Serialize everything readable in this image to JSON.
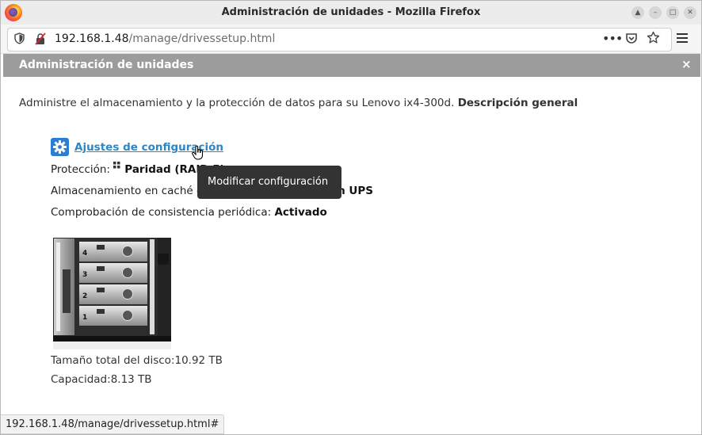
{
  "window": {
    "title": "Administración de unidades - Mozilla Firefox"
  },
  "navbar": {
    "url_host": "192.168.1.48",
    "url_path": "/manage/drivessetup.html",
    "icons": [
      "shield-icon",
      "insecure-lock-icon",
      "more-actions-icon",
      "pocket-icon",
      "bookmark-star-icon",
      "menu-icon"
    ]
  },
  "panel": {
    "title": "Administración de unidades",
    "close_label": "×"
  },
  "intro": {
    "text": "Administre el almacenamiento y la protección de datos para su Lenovo ix4-300d.",
    "link": "Descripción general"
  },
  "settings": {
    "link_label": "Ajustes de configuración",
    "protection_label": "Protección:",
    "protection_value": "Paridad (RAID 5)",
    "cache_label": "Almacenamiento en caché de escritura:",
    "cache_value": "Activado con UPS",
    "consistency_label": "Comprobación de consistencia periódica:",
    "consistency_value": "Activado",
    "tooltip": "Modificar configuración"
  },
  "device": {
    "bays": [
      "4",
      "3",
      "2",
      "1"
    ],
    "total_label": "Tamaño total del disco:",
    "total_value": "10.92 TB",
    "capacity_label": "Capacidad:",
    "capacity_value": "8.13 TB"
  },
  "statusbar": {
    "text": "192.168.1.48/manage/drivessetup.html#"
  },
  "colors": {
    "accent_link": "#2a87c8",
    "gear_bg": "#2a7fd4",
    "panel_header": "#9c9c9c"
  }
}
